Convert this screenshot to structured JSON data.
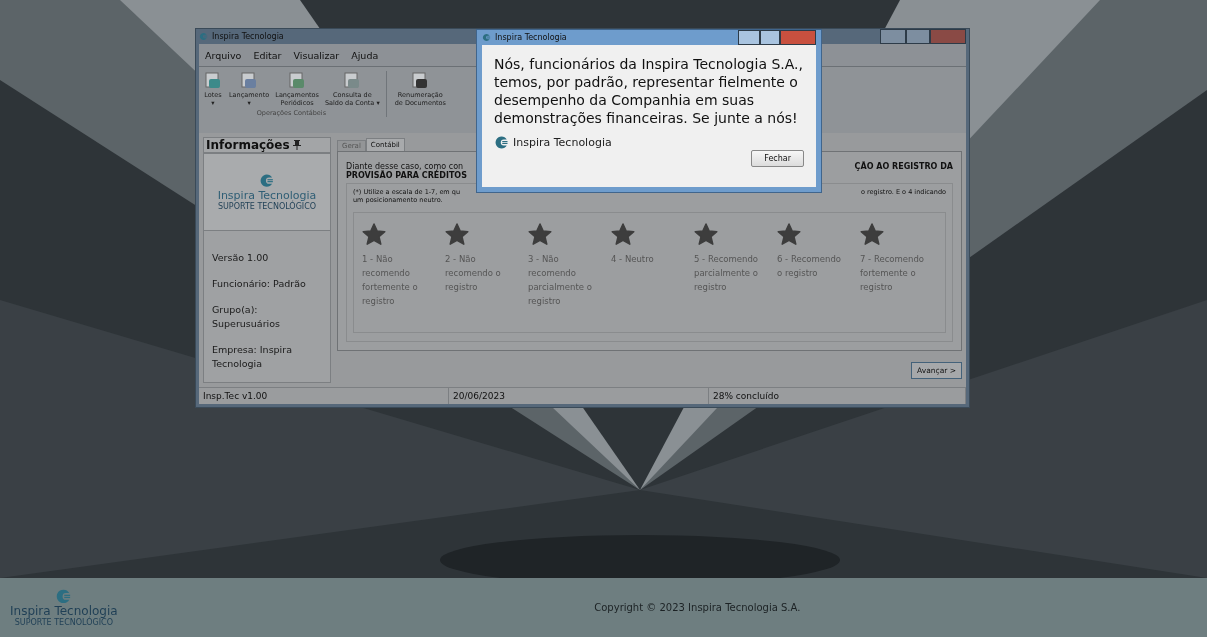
{
  "main_window": {
    "title": "Inspira Tecnologia",
    "menu": [
      "Arquivo",
      "Editar",
      "Visualizar",
      "Ajuda"
    ],
    "toolbar": {
      "group_label": "Operações Contábeis",
      "items": [
        {
          "label": [
            "Lotes"
          ],
          "caret": "▾"
        },
        {
          "label": [
            "Lançamento"
          ],
          "caret": "▾"
        },
        {
          "label": [
            "Lançamentos",
            "Periódicos"
          ]
        },
        {
          "label": [
            "Consulta de",
            "Saldo da Conta ▾"
          ]
        },
        {
          "label": [
            "Renumeração",
            "de Documentos"
          ]
        }
      ]
    },
    "sidebar": {
      "title": "Informações",
      "logo": {
        "name": "Inspira Tecnologia",
        "tagline": "SUPORTE TECNOLÓGICO"
      },
      "lines": [
        "Versão 1.00",
        "Funcionário: Padrão",
        "Grupo(a): Superusuários",
        "Empresa: Inspira Tecnologia"
      ]
    },
    "tabs": [
      {
        "label": "Geral",
        "selected": false
      },
      {
        "label": "Contábil",
        "selected": true
      }
    ],
    "question": {
      "line_1_left": "Diante desse caso, como con",
      "line_1_right": "ÇÃO AO REGISTRO DA",
      "line_2": "PROVISÃO PARA CRÉDITOS"
    },
    "scale_note": {
      "line_1_left": "(*) Utilize a escala de 1-7, em qu",
      "line_1_right": "o registro. E o 4 indicando",
      "line_2": "um posicionamento neutro."
    },
    "options": [
      {
        "label": "1 - Não recomendo fortemente o registro",
        "selected": false
      },
      {
        "label": "2 - Não recomendo o registro",
        "selected": false
      },
      {
        "label": "3 - Não recomendo parcialmente o registro",
        "selected": false
      },
      {
        "label": "4 - Neutro",
        "selected": false
      },
      {
        "label": "5 - Recomendo parcialmente o registro",
        "selected": false
      },
      {
        "label": "6 - Recomendo o registro",
        "selected": false
      },
      {
        "label": "7 - Recomendo fortemente o registro",
        "selected": false
      }
    ],
    "next_button": "Avançar >",
    "status_bar": [
      "Insp.Tec v1.00",
      "20/06/2023",
      "28% concluído"
    ]
  },
  "dialog": {
    "title": "Inspira Tecnologia",
    "message": "Nós, funcionários da Inspira Tecnologia S.A., temos, por padrão, representar fielmente o desempenho da Companhia em suas demonstrações financeiras. Se junte a nós!",
    "brand": "Inspira Tecnologia",
    "button": "Fechar"
  },
  "footer": {
    "logo": {
      "name": "Inspira Tecnologia",
      "tagline": "SUPORTE TECNOLÓGICO"
    },
    "copyright": "Copyright © 2023 Inspira Tecnologia S.A."
  }
}
